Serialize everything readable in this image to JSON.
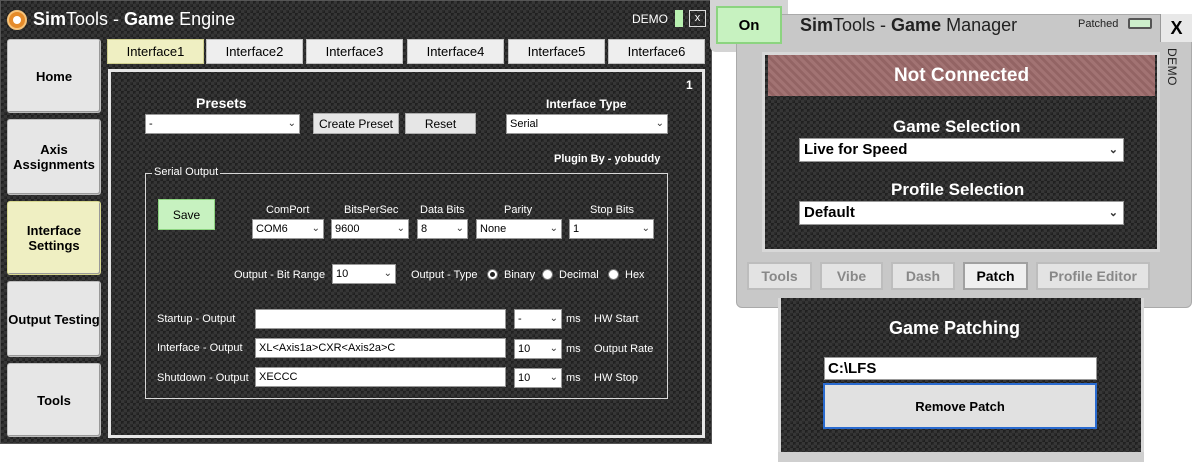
{
  "engine": {
    "title_bold1": "Sim",
    "title_regular1": "Tools - ",
    "title_bold2": "Game",
    "title_regular2": " Engine",
    "demo_label": "DEMO",
    "close_label": "x",
    "sidebar": [
      {
        "label": "Home"
      },
      {
        "label": "Axis Assignments"
      },
      {
        "label": "Interface Settings"
      },
      {
        "label": "Output Testing"
      },
      {
        "label": "Tools"
      }
    ],
    "tabs": [
      {
        "label": "Interface1"
      },
      {
        "label": "Interface2"
      },
      {
        "label": "Interface3"
      },
      {
        "label": "Interface4"
      },
      {
        "label": "Interface5"
      },
      {
        "label": "Interface6"
      }
    ],
    "panel": {
      "number": "1",
      "presets_label": "Presets",
      "presets_value": "-",
      "create_preset": "Create Preset",
      "reset": "Reset",
      "interface_type_label": "Interface Type",
      "interface_type_value": "Serial",
      "plugin_by": "Plugin By - yobuddy",
      "serial_output_label": "Serial Output",
      "save": "Save",
      "comport_label": "ComPort",
      "comport_value": "COM6",
      "bps_label": "BitsPerSec",
      "bps_value": "9600",
      "databits_label": "Data Bits",
      "databits_value": "8",
      "parity_label": "Parity",
      "parity_value": "None",
      "stopbits_label": "Stop Bits",
      "stopbits_value": "1",
      "bitrange_label": "Output - Bit Range",
      "bitrange_value": "10",
      "output_type_label": "Output - Type",
      "type_binary": "Binary",
      "type_decimal": "Decimal",
      "type_hex": "Hex",
      "selected_type": "Binary",
      "startup_label": "Startup - Output",
      "startup_value": "",
      "startup_ms": "-",
      "ms": "ms",
      "hw_start": "HW Start",
      "interface_label": "Interface - Output",
      "interface_value": "XL<Axis1a>CXR<Axis2a>C",
      "interface_ms": "10",
      "output_rate": "Output Rate",
      "shutdown_label": "Shutdown - Output",
      "shutdown_value": "XECCC",
      "shutdown_ms": "10",
      "hw_stop": "HW Stop"
    }
  },
  "manager": {
    "on_label": "On",
    "title_bold1": "Sim",
    "title_regular1": "Tools - ",
    "title_bold2": "Game",
    "title_regular2": " Manager",
    "patched_label": "Patched",
    "close_label": "X",
    "demo_vertical": "DEMO",
    "status": "Not Connected",
    "game_selection_label": "Game Selection",
    "game_selection_value": "Live for Speed",
    "profile_selection_label": "Profile Selection",
    "profile_selection_value": "Default",
    "tabs": [
      {
        "label": "Tools"
      },
      {
        "label": "Vibe"
      },
      {
        "label": "Dash"
      },
      {
        "label": "Patch"
      },
      {
        "label": "Profile Editor"
      }
    ],
    "patching_title": "Game Patching",
    "patch_path": "C:\\LFS",
    "remove_patch": "Remove Patch"
  },
  "colors": {
    "carbon": "#2b2b2b",
    "active_yellow": "#efefc2",
    "on_green": "#c7f2c0",
    "not_connected": "#9c6a6a",
    "focus_blue": "#2a6bd0"
  }
}
